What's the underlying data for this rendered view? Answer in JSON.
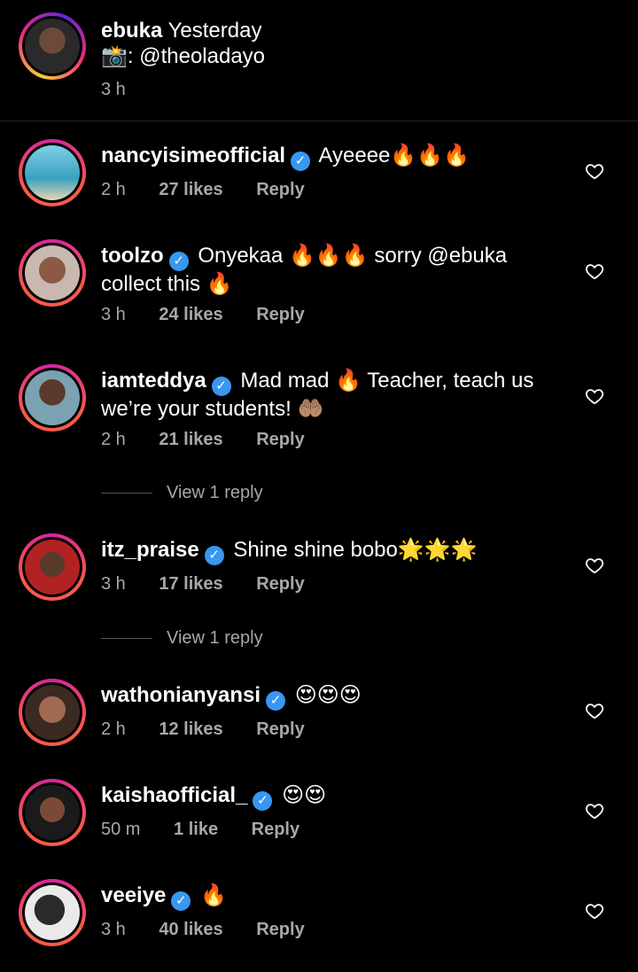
{
  "caption": {
    "username": "ebuka",
    "text1": "Yesterday",
    "line2_emoji": "📸",
    "line2_text": ": @theoladayo",
    "time": "3 h"
  },
  "comments": [
    {
      "username": "nancyisimeofficial",
      "verified": true,
      "text": "Ayeeee🔥🔥🔥",
      "time": "2 h",
      "likes": "27 likes",
      "reply": "Reply",
      "view_replies": ""
    },
    {
      "username": "toolzo",
      "verified": true,
      "text": "Onyekaa 🔥🔥🔥 sorry @ebuka collect this 🔥",
      "time": "3 h",
      "likes": "24 likes",
      "reply": "Reply",
      "view_replies": ""
    },
    {
      "username": "iamteddya",
      "verified": true,
      "text": "Mad mad 🔥 Teacher, teach us we’re your students! 🤲🏽",
      "time": "2 h",
      "likes": "21 likes",
      "reply": "Reply",
      "view_replies": "View 1 reply"
    },
    {
      "username": "itz_praise",
      "verified": true,
      "text": "Shine shine bobo🌟🌟🌟",
      "time": "3 h",
      "likes": "17 likes",
      "reply": "Reply",
      "view_replies": "View 1 reply"
    },
    {
      "username": "wathonianyansi",
      "verified": true,
      "text": "😍😍😍",
      "time": "2 h",
      "likes": "12 likes",
      "reply": "Reply",
      "view_replies": ""
    },
    {
      "username": "kaishaofficial_",
      "verified": true,
      "text": "😍😍",
      "time": "50 m",
      "likes": "1 like",
      "reply": "Reply",
      "view_replies": ""
    },
    {
      "username": "veeiye",
      "verified": true,
      "text": "🔥",
      "time": "3 h",
      "likes": "40 likes",
      "reply": "Reply",
      "view_replies": ""
    }
  ],
  "icons": {
    "verified": "verified-badge-icon",
    "heart": "heart-outline-icon"
  },
  "colors": {
    "verified": "#3897f0",
    "meta": "#a8a8a8",
    "background": "#000000"
  }
}
